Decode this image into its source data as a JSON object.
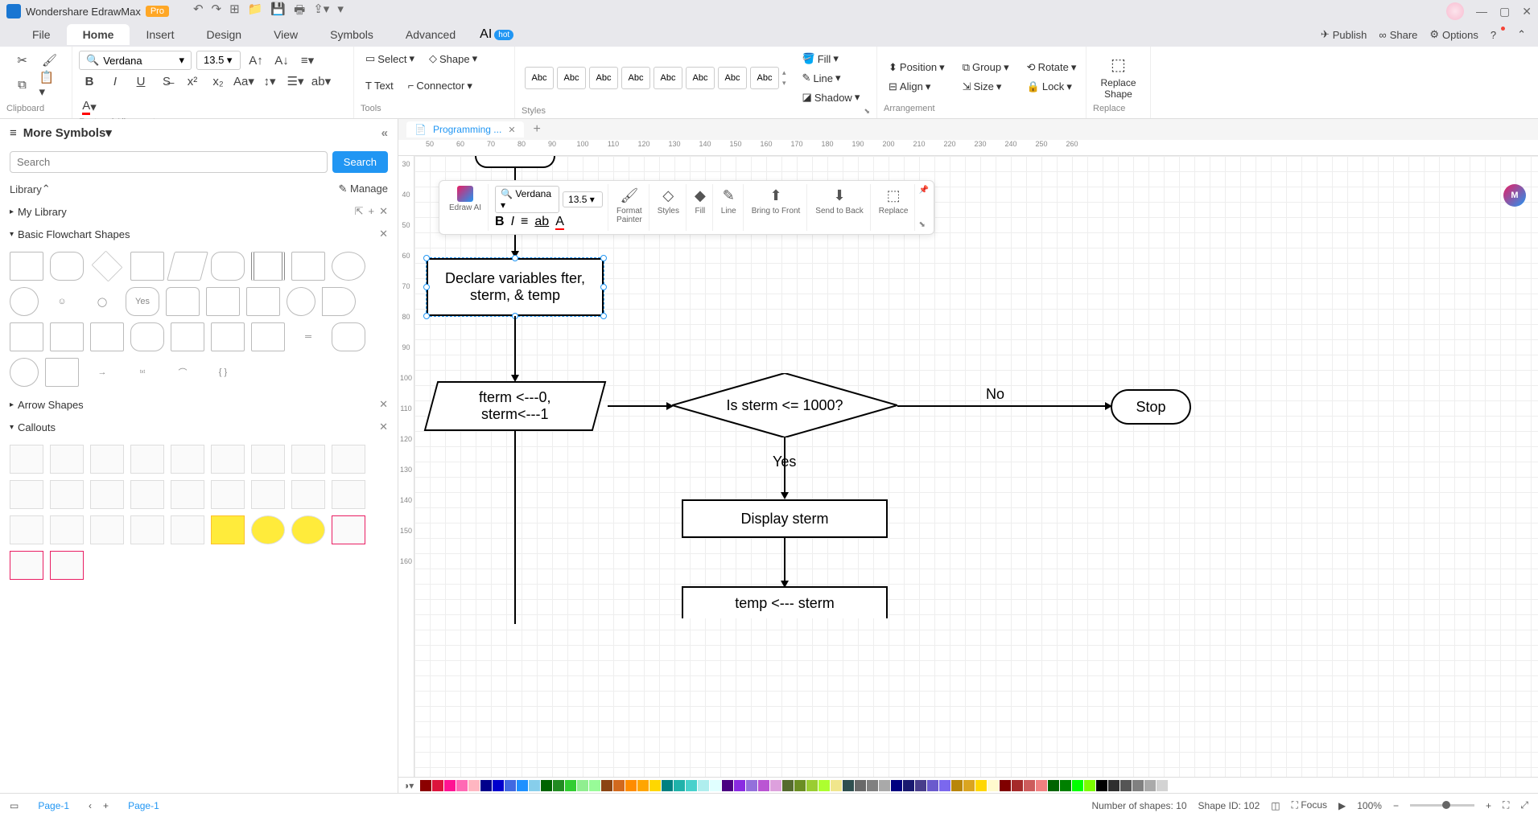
{
  "app": {
    "name": "Wondershare EdrawMax",
    "badge": "Pro"
  },
  "menus": [
    "File",
    "Home",
    "Insert",
    "Design",
    "View",
    "Symbols",
    "Advanced"
  ],
  "activeMenu": "Home",
  "ai": {
    "label": "AI",
    "badge": "hot"
  },
  "topright": {
    "publish": "Publish",
    "share": "Share",
    "options": "Options"
  },
  "ribbon": {
    "clipboard": "Clipboard",
    "font": "Verdana",
    "size": "13.5",
    "fontgroup": "Font and Alignment",
    "tools": "Tools",
    "select": "Select",
    "text": "Text",
    "shape": "Shape",
    "connector": "Connector",
    "styles": "Styles",
    "swatch": "Abc",
    "fill": "Fill",
    "line": "Line",
    "shadow": "Shadow",
    "position": "Position",
    "align": "Align",
    "group": "Group",
    "size_lbl": "Size",
    "rotate": "Rotate",
    "lock": "Lock",
    "arrangement": "Arrangement",
    "replace_shape": "Replace\nShape",
    "replace": "Replace"
  },
  "panel": {
    "title": "More Symbols",
    "search_ph": "Search",
    "search_btn": "Search",
    "library": "Library",
    "manage": "Manage",
    "mylib": "My Library",
    "basic": "Basic Flowchart Shapes",
    "arrow": "Arrow Shapes",
    "callouts": "Callouts",
    "yes": "Yes"
  },
  "doc": {
    "tab": "Programming ...",
    "page": "Page-1"
  },
  "ruler_h": [
    50,
    60,
    70,
    80,
    90,
    100,
    110,
    120,
    130,
    140,
    150,
    160,
    170,
    180,
    190,
    200,
    210,
    220,
    230,
    240,
    250,
    260
  ],
  "ruler_v": [
    30,
    40,
    50,
    60,
    70,
    80,
    90,
    100,
    110,
    120,
    130,
    140,
    150,
    160
  ],
  "flowchart": {
    "declare": "Declare variables fter,\nsterm, & temp",
    "init": "fterm <---0,\nsterm<---1",
    "cond": "Is sterm <= 1000?",
    "yes": "Yes",
    "no": "No",
    "display": "Display sterm",
    "assign": "temp <--- sterm",
    "stop": "Stop"
  },
  "float": {
    "edrawai": "Edraw AI",
    "font": "Verdana",
    "size": "13.5",
    "format": "Format\nPainter",
    "styles": "Styles",
    "fill": "Fill",
    "line": "Line",
    "front": "Bring to Front",
    "back": "Send to Back",
    "replace": "Replace"
  },
  "colors": [
    "#8b0000",
    "#dc143c",
    "#ff1493",
    "#ff69b4",
    "#ffb6c1",
    "#00008b",
    "#0000cd",
    "#4169e1",
    "#1e90ff",
    "#87ceeb",
    "#006400",
    "#228b22",
    "#32cd32",
    "#90ee90",
    "#98fb98",
    "#8b4513",
    "#d2691e",
    "#ff8c00",
    "#ffa500",
    "#ffd700",
    "#008080",
    "#20b2aa",
    "#48d1cc",
    "#afeeee",
    "#e0ffff",
    "#4b0082",
    "#8a2be2",
    "#9370db",
    "#ba55d3",
    "#dda0dd",
    "#556b2f",
    "#6b8e23",
    "#9acd32",
    "#adff2f",
    "#f0e68c",
    "#2f4f4f",
    "#696969",
    "#808080",
    "#a9a9a9",
    "#000080",
    "#191970",
    "#483d8b",
    "#6a5acd",
    "#7b68ee",
    "#b8860b",
    "#daa520",
    "#ffd700",
    "#fffacd",
    "#800000",
    "#a52a2a",
    "#cd5c5c",
    "#f08080",
    "#006400",
    "#008000",
    "#00ff00",
    "#7cfc00",
    "#000000",
    "#2f2f2f",
    "#555555",
    "#808080",
    "#aaaaaa",
    "#d3d3d3",
    "#ffffff"
  ],
  "status": {
    "shapes": "Number of shapes: 10",
    "shapeid": "Shape ID: 102",
    "focus": "Focus",
    "zoom": "100%"
  }
}
